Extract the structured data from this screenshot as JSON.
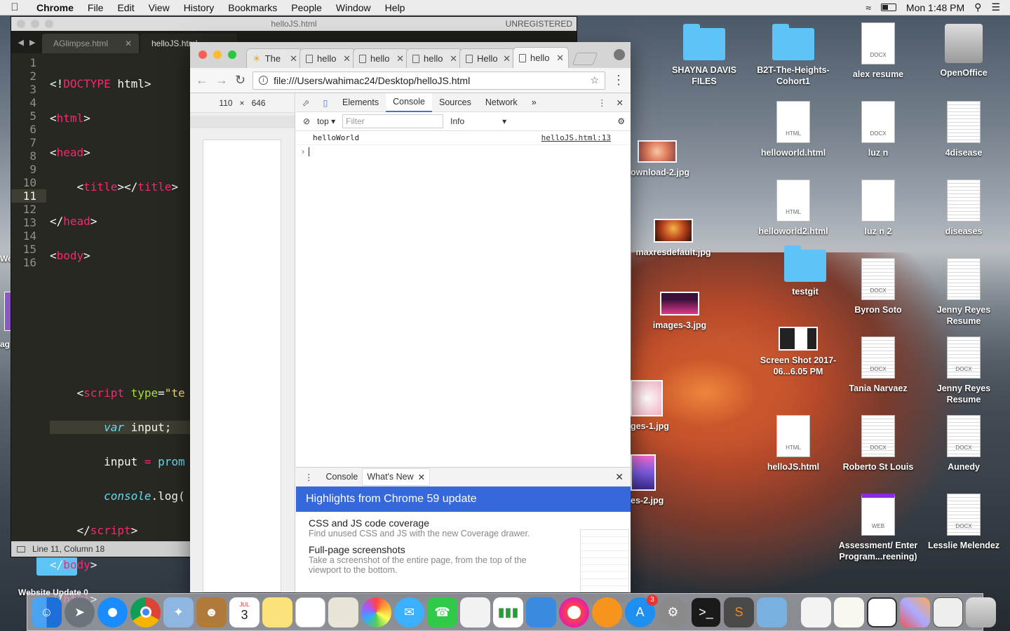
{
  "menubar": {
    "app": "Chrome",
    "items": [
      "File",
      "Edit",
      "View",
      "History",
      "Bookmarks",
      "People",
      "Window",
      "Help"
    ],
    "clock": "Mon 1:48 PM"
  },
  "sublime": {
    "title": "helloJS.html",
    "unregistered": "UNREGISTERED",
    "tabs": [
      "AGlimpse.html",
      "helloJS.html"
    ],
    "status": "Line 11, Column 18",
    "line_numbers": [
      "1",
      "2",
      "3",
      "4",
      "5",
      "6",
      "7",
      "8",
      "9",
      "10",
      "11",
      "12",
      "13",
      "14",
      "15",
      "16"
    ]
  },
  "chrome": {
    "tabs": [
      "The",
      "hello",
      "hello",
      "hello",
      "Hello",
      "hello"
    ],
    "url": "file:///Users/wahimac24/Desktop/helloJS.html",
    "viewport_width": "110",
    "viewport_height": "646",
    "viewport_sep": "×",
    "devtools": {
      "tabs": [
        "Elements",
        "Console",
        "Sources",
        "Network"
      ],
      "active_tab": "Console",
      "more": "»",
      "context": "top",
      "filter_placeholder": "Filter",
      "level": "Info",
      "log_message": "helloWorld",
      "log_source": "helloJS.html:13",
      "drawer_tabs": [
        "Console",
        "What's New"
      ],
      "banner": "Highlights from Chrome 59 update",
      "items": [
        {
          "title": "CSS and JS code coverage",
          "desc": "Find unused CSS and JS with the new Coverage drawer."
        },
        {
          "title": "Full-page screenshots",
          "desc": "Take a screenshot of the entire page, from the top of the viewport to the bottom."
        }
      ]
    }
  },
  "desktop": {
    "icons": [
      {
        "label": "SHAYNA DAVIS FILES",
        "kind": "folder"
      },
      {
        "label": "B2T-The-Heights-Cohort1",
        "kind": "folder"
      },
      {
        "label": "alex resume",
        "kind": "DOCX"
      },
      {
        "label": "OpenOffice",
        "kind": "disk"
      },
      {
        "label": "helloworld.html",
        "kind": "HTML"
      },
      {
        "label": "luz n",
        "kind": "DOCX"
      },
      {
        "label": "4disease",
        "kind": "doc"
      },
      {
        "label": "ownload-2.jpg",
        "kind": "image"
      },
      {
        "label": "helloworld2.html",
        "kind": "HTML"
      },
      {
        "label": "luz n 2",
        "kind": "doc"
      },
      {
        "label": "diseases",
        "kind": "doc"
      },
      {
        "label": "maxresdefault.jpg",
        "kind": "image"
      },
      {
        "label": "testgit",
        "kind": "folder"
      },
      {
        "label": "Byron Soto",
        "kind": "DOCX"
      },
      {
        "label": "Jenny Reyes Resume",
        "kind": "doc"
      },
      {
        "label": "images-3.jpg",
        "kind": "image"
      },
      {
        "label": "Screen Shot 2017-06...6.05 PM",
        "kind": "image"
      },
      {
        "label": "Tania Narvaez",
        "kind": "DOCX"
      },
      {
        "label": "Jenny Reyes Resume",
        "kind": "DOCX"
      },
      {
        "label": "ges-1.jpg",
        "kind": "image"
      },
      {
        "label": "helloJS.html",
        "kind": "HTML"
      },
      {
        "label": "Roberto St Louis",
        "kind": "DOCX"
      },
      {
        "label": "Aunedy",
        "kind": "DOCX"
      },
      {
        "label": "es-2.jpg",
        "kind": "image"
      },
      {
        "label": "Assessment/ Enter Program...reening)",
        "kind": "WEB"
      },
      {
        "label": "Lesslie Melendez",
        "kind": "DOCX"
      }
    ],
    "left_edge": [
      "We",
      "ag"
    ],
    "bottom_left_label": "Website Update 0"
  },
  "dock": {
    "calendar_month": "JUL",
    "calendar_day": "3",
    "appstore_badge": "3"
  }
}
